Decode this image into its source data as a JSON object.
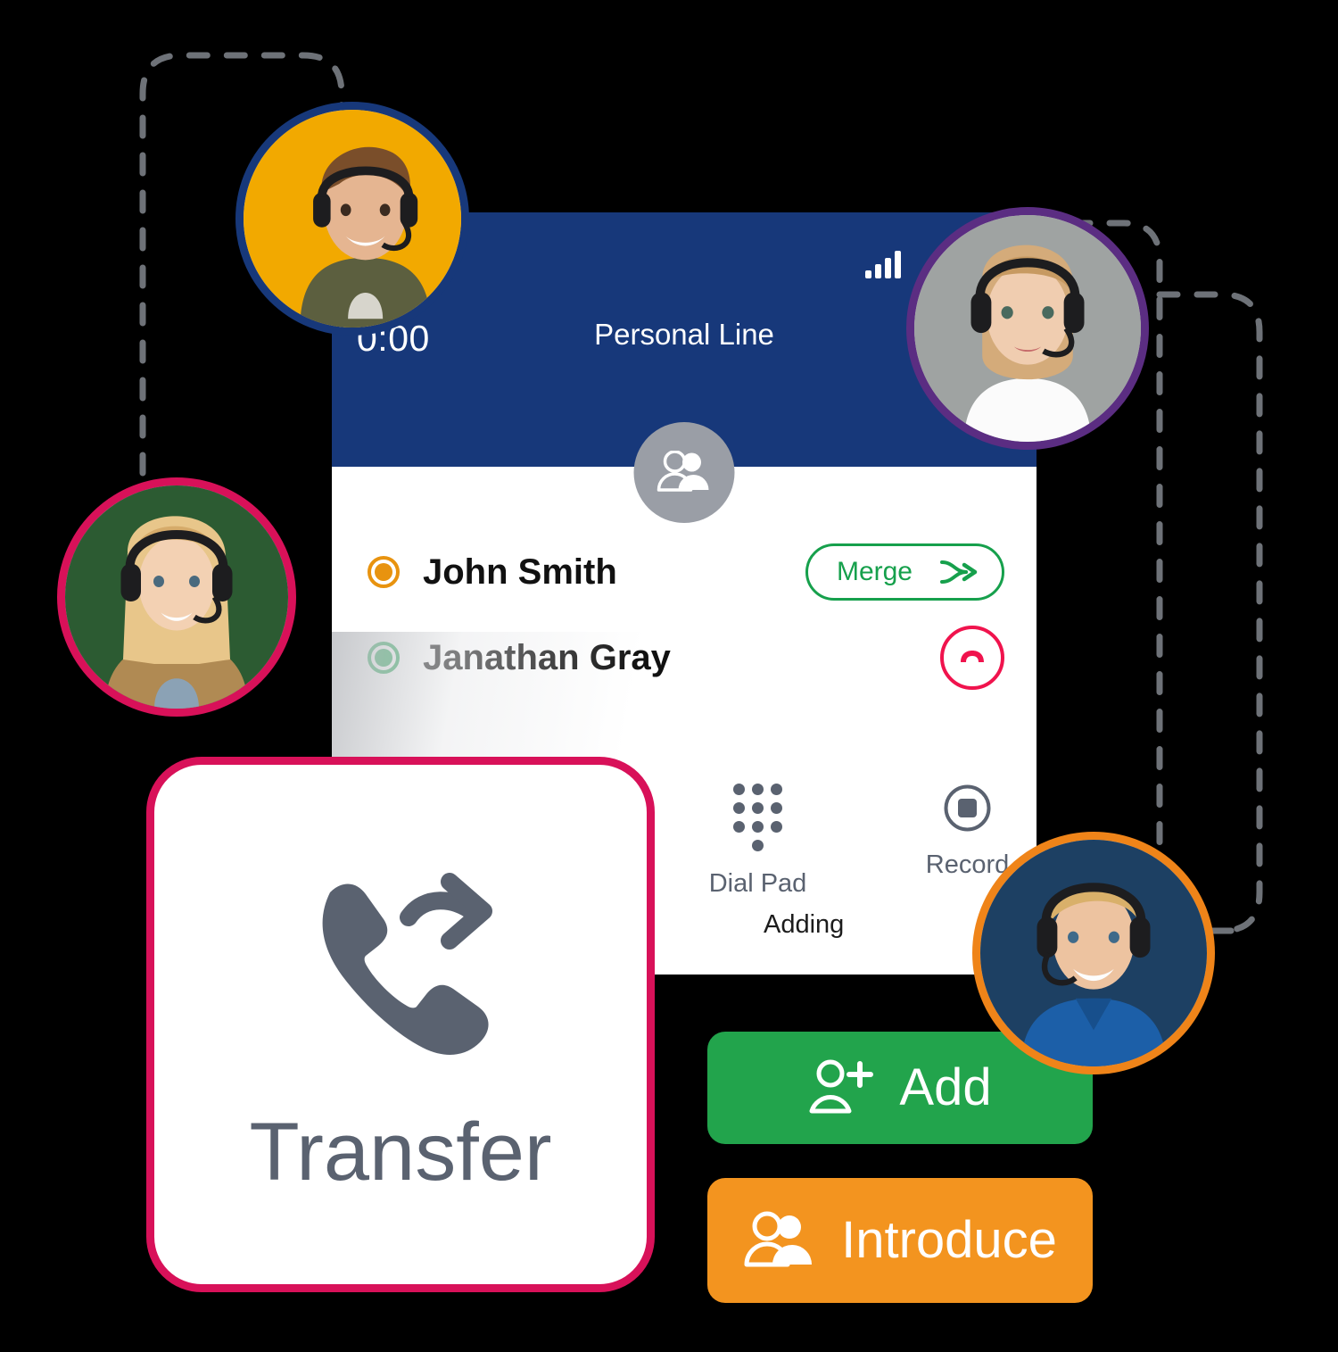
{
  "panel": {
    "header": {
      "timer": "0:00",
      "line_title": "Personal Line",
      "signal_icon": "signal-bars-icon",
      "group_icon": "group-people-icon",
      "background_color": "#17387A"
    },
    "participants": [
      {
        "name": "John Smith",
        "status_dot_color": "#E8930F",
        "status_dot_name": "status-dot-on-hold",
        "action": {
          "type": "merge",
          "label": "Merge",
          "icon": "merge-arrow-icon",
          "color": "#16A04C"
        }
      },
      {
        "name": "Janathan Gray",
        "status_dot_color": "#16A04C",
        "status_dot_name": "status-dot-active",
        "substatus": "Adding",
        "action": {
          "type": "end-call",
          "label": "",
          "icon": "hangup-phone-icon",
          "color": "#F0134D"
        }
      }
    ],
    "actions": [
      {
        "label": "Dial Pad",
        "icon": "dialpad-icon"
      },
      {
        "label": "Record",
        "icon": "record-stop-icon"
      }
    ]
  },
  "transfer_card": {
    "label": "Transfer",
    "icon": "phone-forward-icon",
    "border_color": "#D81159",
    "icon_color": "#5A6270"
  },
  "buttons": [
    {
      "label": "Add",
      "icon": "person-plus-icon",
      "color": "#22A44C"
    },
    {
      "label": "Introduce",
      "icon": "two-people-icon",
      "color": "#F3941F"
    }
  ],
  "avatars": [
    {
      "name": "agent-top",
      "ring_color": "#17387A",
      "background_color": "#F2A900"
    },
    {
      "name": "agent-right",
      "ring_color": "#5B2D82",
      "background_color": "#9FA3A2"
    },
    {
      "name": "agent-left",
      "ring_color": "#D81159",
      "background_color": "#2C5B32"
    },
    {
      "name": "agent-bottom",
      "ring_color": "#EF8419",
      "background_color": "#1D4063"
    }
  ],
  "connectors": {
    "line_color": "#6E7278",
    "style": "dashed"
  }
}
